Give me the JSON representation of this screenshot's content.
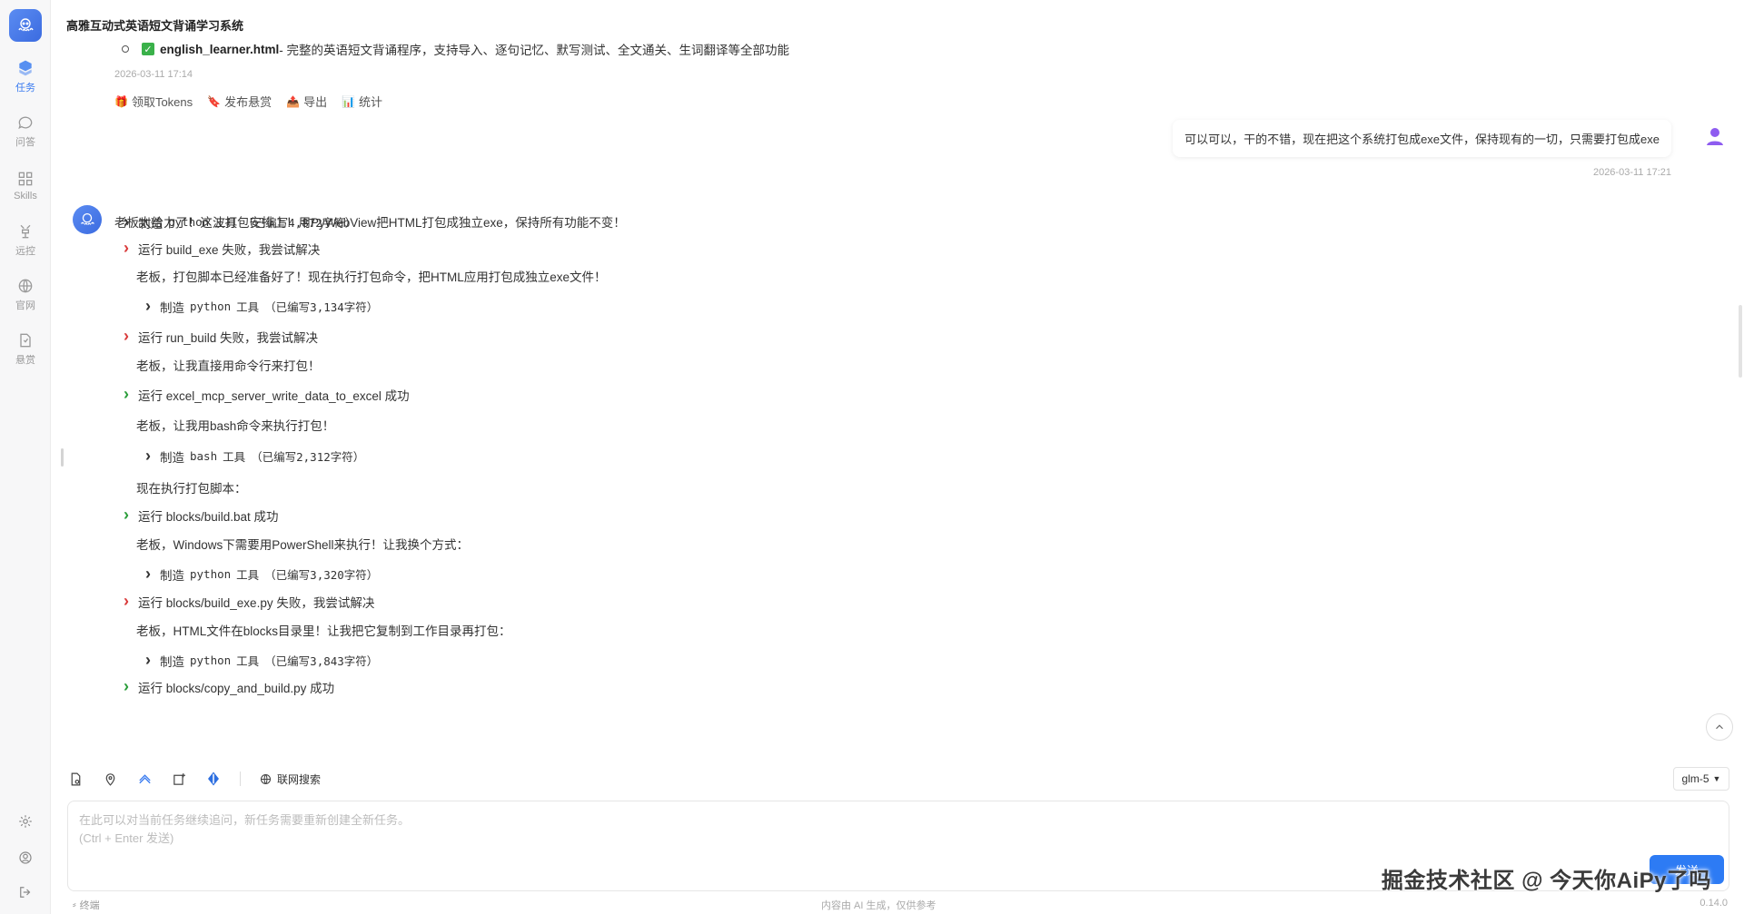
{
  "header": {
    "title": "高雅互动式英语短文背诵学习系统"
  },
  "sidebar": {
    "items": [
      {
        "label": "任务",
        "icon": "cube-icon"
      },
      {
        "label": "问答",
        "icon": "chat-bubble-icon"
      },
      {
        "label": "Skills",
        "icon": "grid-icon"
      },
      {
        "label": "远控",
        "icon": "remote-icon"
      },
      {
        "label": "官网",
        "icon": "globe-icon"
      },
      {
        "label": "悬赏",
        "icon": "reward-icon"
      }
    ]
  },
  "chat": {
    "prev_item": {
      "filename": "english_learner.html",
      "desc": " - 完整的英语短文背诵程序，支持导入、逐句记忆、默写测试、全文通关、生词翻译等全部功能"
    },
    "prev_time": "2026-03-11 17:14",
    "actions": [
      {
        "label": "领取Tokens",
        "icon": "🎁"
      },
      {
        "label": "发布悬赏",
        "icon": "🔖"
      },
      {
        "label": "导出",
        "icon": "📤"
      },
      {
        "label": "统计",
        "icon": "📊"
      }
    ],
    "user_message": "可以可以，干的不错，现在把这个系统打包成exe文件，保持现有的一切，只需要打包成exe",
    "user_time": "2026-03-11 17:21",
    "bot_intro": "老板太给力了！这波打包安排上！用PyWebView把HTML打包成独立exe，保持所有功能不变！",
    "steps": [
      {
        "type": "tool",
        "status": "neutral",
        "prefix": "制造",
        "tool": "python",
        "word": "工具",
        "count": "（已编写4,872字符）",
        "indent": 0
      },
      {
        "type": "run",
        "status": "fail",
        "text": "运行 build_exe 失败，我尝试解决"
      },
      {
        "type": "note",
        "text": "老板，打包脚本已经准备好了！现在执行打包命令，把HTML应用打包成独立exe文件！"
      },
      {
        "type": "tool",
        "status": "neutral",
        "prefix": "制造",
        "tool": "python",
        "word": "工具",
        "count": "（已编写3,134字符）",
        "indent": 1
      },
      {
        "type": "run",
        "status": "fail",
        "text": "运行 run_build 失败，我尝试解决"
      },
      {
        "type": "note",
        "text": "老板，让我直接用命令行来打包！"
      },
      {
        "type": "run",
        "status": "ok",
        "text": "运行 excel_mcp_server_write_data_to_excel 成功"
      },
      {
        "type": "note",
        "text": "老板，让我用bash命令来执行打包！"
      },
      {
        "type": "tool",
        "status": "neutral",
        "prefix": "制造",
        "tool": "bash",
        "word": "工具",
        "count": "（已编写2,312字符）",
        "indent": 1
      },
      {
        "type": "note",
        "text": "现在执行打包脚本："
      },
      {
        "type": "run",
        "status": "ok",
        "text": "运行 blocks/build.bat 成功"
      },
      {
        "type": "note",
        "text": "老板，Windows下需要用PowerShell来执行！让我换个方式："
      },
      {
        "type": "tool",
        "status": "neutral",
        "prefix": "制造",
        "tool": "python",
        "word": "工具",
        "count": "（已编写3,320字符）",
        "indent": 1
      },
      {
        "type": "run",
        "status": "fail",
        "text": "运行 blocks/build_exe.py 失败，我尝试解决"
      },
      {
        "type": "note",
        "text": "老板，HTML文件在blocks目录里！让我把它复制到工作目录再打包："
      },
      {
        "type": "tool",
        "status": "neutral",
        "prefix": "制造",
        "tool": "python",
        "word": "工具",
        "count": "（已编写3,843字符）",
        "indent": 1
      },
      {
        "type": "run",
        "status": "ok",
        "text": "运行 blocks/copy_and_build.py 成功"
      }
    ]
  },
  "input": {
    "web_search_label": "联网搜索",
    "model": "glm-5",
    "placeholder": "在此可以对当前任务继续追问，新任务需要重新创建全新任务。\n(Ctrl + Enter 发送)",
    "send_label": "发送"
  },
  "watermark": "掘金技术社区 @ 今天你AiPy了吗",
  "footer": {
    "left": "终端",
    "center": "内容由 AI 生成，仅供参考",
    "right": "0.14.0"
  },
  "colors": {
    "accent": "#2d7bf4",
    "success": "#2a9d3a",
    "fail": "#d93a3a"
  }
}
